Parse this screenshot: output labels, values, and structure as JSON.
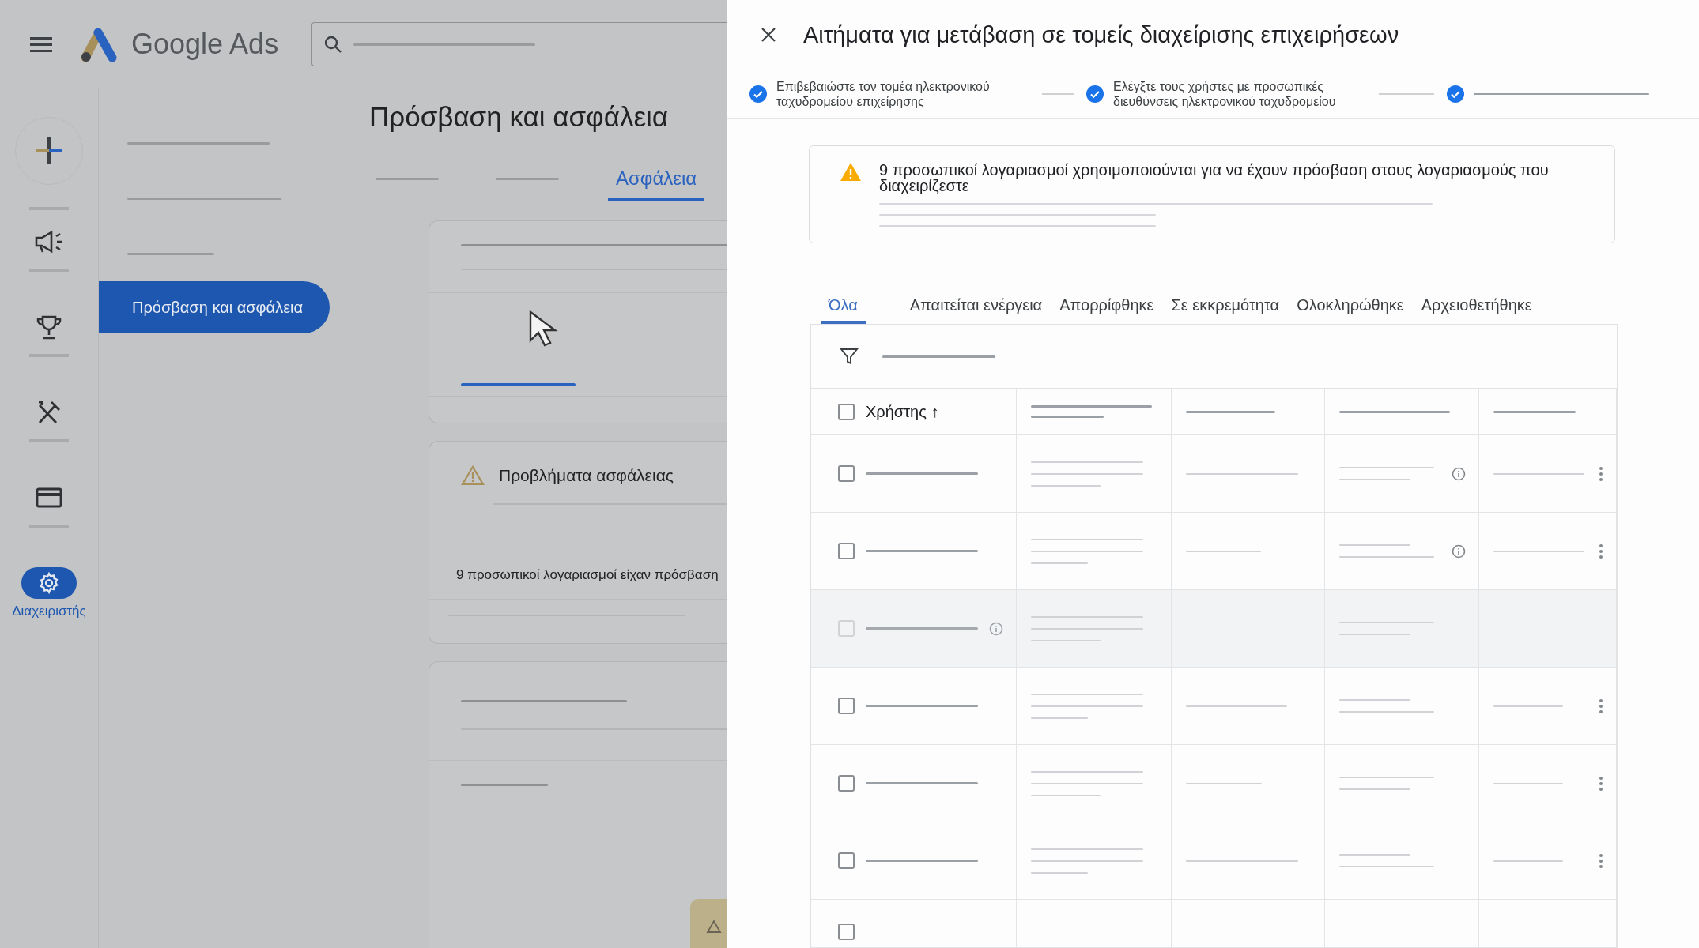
{
  "header": {
    "product_name": "Google Ads"
  },
  "rail": {
    "items": [
      {
        "selected": false
      },
      {
        "selected": false
      },
      {
        "selected": false
      },
      {
        "selected": false
      },
      {
        "selected": false
      },
      {
        "label": "Διαχειριστής",
        "selected": true
      }
    ]
  },
  "nav": {
    "items": [
      {
        "selected": false
      },
      {
        "selected": false
      },
      {
        "selected": false
      },
      {
        "label": "Πρόσβαση και ασφάλεια",
        "selected": true
      }
    ]
  },
  "page": {
    "title": "Πρόσβαση και ασφάλεια",
    "tabs": [
      {
        "selected": false
      },
      {
        "selected": false
      },
      {
        "label": "Ασφάλεια",
        "selected": true
      }
    ],
    "issues_card": {
      "title": "Προβλήματα ασφάλειας",
      "text": "9 προσωπικοί λογαριασμοί είχαν πρόσβαση"
    }
  },
  "panel": {
    "title": "Αιτήματα για μετάβαση σε τομείς διαχείρισης επιχειρήσεων",
    "steps": [
      {
        "label": "Επιβεβαιώστε τον τομέα ηλεκτρονικού ταχυδρομείου επιχείρησης",
        "done": true
      },
      {
        "label": "Ελέγξτε τους χρήστες με προσωπικές διευθύνσεις ηλεκτρονικού ταχυδρομείου",
        "done": true
      },
      {
        "done": true
      }
    ],
    "alert": {
      "text": "9 προσωπικοί λογαριασμοί χρησιμοποιούνται για να έχουν πρόσβαση στους λογαριασμούς που διαχειρίζεστε"
    },
    "tabs": [
      {
        "label": "Όλα",
        "selected": true
      },
      {
        "label": "Απαιτείται ενέργεια",
        "selected": false
      },
      {
        "label": "Απορρίφθηκε",
        "selected": false
      },
      {
        "label": "Σε εκκρεμότητα",
        "selected": false
      },
      {
        "label": "Ολοκληρώθηκε",
        "selected": false
      },
      {
        "label": "Αρχειοθετήθηκε",
        "selected": false
      }
    ],
    "table": {
      "header": {
        "label": "Χρήστης ↑",
        "checked": false
      },
      "rows": [
        {
          "kind": "flagged",
          "checked": false
        },
        {
          "kind": "flagged",
          "checked": false
        },
        {
          "kind": "disabled",
          "checked": false
        },
        {
          "kind": "plain",
          "checked": false
        },
        {
          "kind": "plain",
          "checked": false
        },
        {
          "kind": "plain",
          "checked": false
        },
        {
          "kind": "partial",
          "checked": false
        }
      ]
    }
  }
}
